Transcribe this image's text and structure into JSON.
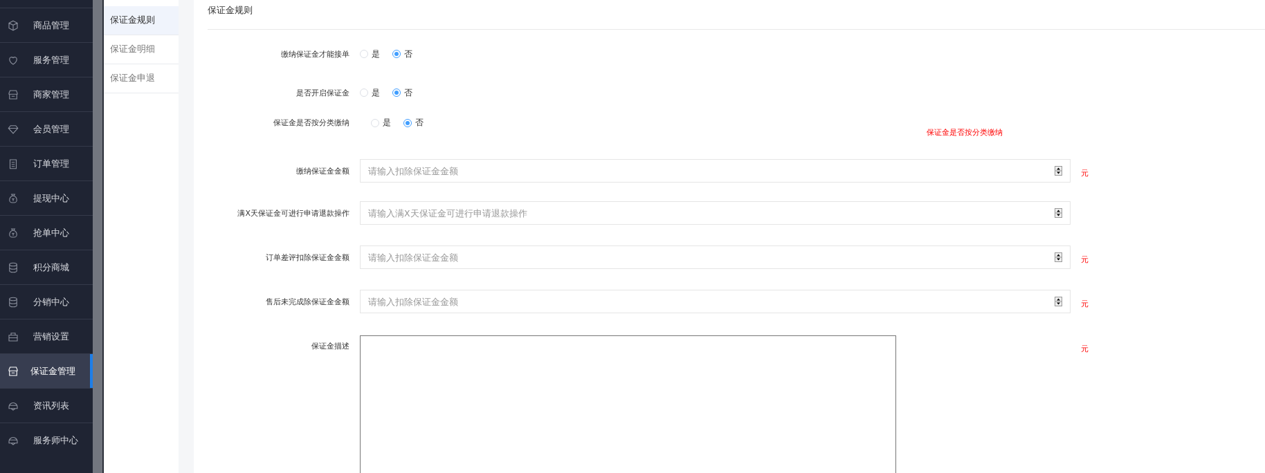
{
  "sidebar": {
    "items": [
      {
        "label": "商品管理",
        "kind": "box",
        "selected": false
      },
      {
        "label": "服务管理",
        "kind": "heart",
        "selected": false
      },
      {
        "label": "商家管理",
        "kind": "shop",
        "selected": false
      },
      {
        "label": "会员管理",
        "kind": "diamond",
        "selected": false
      },
      {
        "label": "订单管理",
        "kind": "clipboard",
        "selected": false
      },
      {
        "label": "提现中心",
        "kind": "moneybag",
        "selected": false
      },
      {
        "label": "抢单中心",
        "kind": "moneybag",
        "selected": false
      },
      {
        "label": "积分商城",
        "kind": "coins",
        "selected": false
      },
      {
        "label": "分销中心",
        "kind": "coins",
        "selected": false
      },
      {
        "label": "营销设置",
        "kind": "toolbox",
        "selected": false
      },
      {
        "label": "保证金管理",
        "kind": "shop",
        "selected": true
      },
      {
        "label": "资讯列表",
        "kind": "helmet",
        "selected": false
      },
      {
        "label": "服务师中心",
        "kind": "helmet",
        "selected": false
      }
    ]
  },
  "submenu": {
    "items": [
      {
        "label": "保证金规则",
        "selected": true
      },
      {
        "label": "保证金明细",
        "selected": false
      },
      {
        "label": "保证金申退",
        "selected": false
      }
    ]
  },
  "form": {
    "title": "保证金规则",
    "fields": [
      {
        "kind": "radio",
        "label": "缴纳保证金才能接单",
        "options": [
          {
            "label": "是",
            "selected": false
          },
          {
            "label": "否",
            "selected": true
          }
        ]
      },
      {
        "kind": "radio",
        "label": "是否开启保证金",
        "options": [
          {
            "label": "是",
            "selected": false
          },
          {
            "label": "否",
            "selected": true
          }
        ]
      },
      {
        "kind": "radio",
        "label": "保证金是否按分类缴纳",
        "hint": "保证金是否按分类缴纳",
        "options": [
          {
            "label": "是",
            "selected": false
          },
          {
            "label": "否",
            "selected": true
          }
        ]
      },
      {
        "kind": "number",
        "label": "缴纳保证金金额",
        "placeholder": "请输入扣除保证金金额",
        "unit": "元"
      },
      {
        "kind": "number",
        "label": "满X天保证金可进行申请退款操作",
        "placeholder": "请输入满X天保证金可进行申请退款操作"
      },
      {
        "kind": "number",
        "label": "订单差评扣除保证金金额",
        "placeholder": "请输入扣除保证金金额",
        "unit": "元"
      },
      {
        "kind": "number",
        "label": "售后未完成除保证金金额",
        "placeholder": "请输入扣除保证金金额",
        "unit": "元"
      },
      {
        "kind": "textarea",
        "label": "保证金描述",
        "unit": "元"
      }
    ]
  }
}
